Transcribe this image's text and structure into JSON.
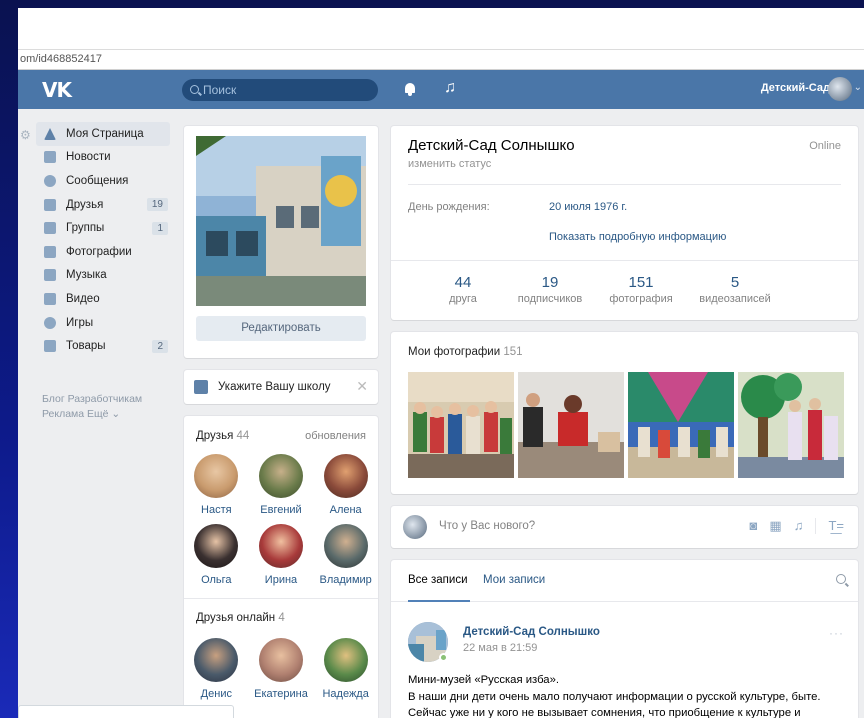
{
  "browser": {
    "url": "om/id468852417"
  },
  "header": {
    "logo": "VK",
    "search_placeholder": "Поиск",
    "user_name": "Детский-Сад",
    "icons": [
      "bell-icon",
      "music-icon",
      "chevron-down-icon"
    ]
  },
  "sidebar": {
    "items": [
      {
        "label": "Моя Страница",
        "icon": "house-icon",
        "badge": ""
      },
      {
        "label": "Новости",
        "icon": "news-icon",
        "badge": ""
      },
      {
        "label": "Сообщения",
        "icon": "message-icon",
        "badge": ""
      },
      {
        "label": "Друзья",
        "icon": "person-icon",
        "badge": "19"
      },
      {
        "label": "Группы",
        "icon": "group-icon",
        "badge": "1"
      },
      {
        "label": "Фотографии",
        "icon": "camera-icon",
        "badge": ""
      },
      {
        "label": "Музыка",
        "icon": "music-icon",
        "badge": ""
      },
      {
        "label": "Видео",
        "icon": "film-icon",
        "badge": ""
      },
      {
        "label": "Игры",
        "icon": "gamepad-icon",
        "badge": ""
      },
      {
        "label": "Товары",
        "icon": "bag-icon",
        "badge": "2"
      }
    ],
    "footer": {
      "line1": "Блог  Разработчикам",
      "line2": "Реклама  Ещё ⌄"
    }
  },
  "avatar_card": {
    "edit_label": "Редактировать"
  },
  "school": {
    "label": "Укажите Вашу школу",
    "close": "✕"
  },
  "friends": {
    "title": "Друзья",
    "count": "44",
    "updates": "обновления",
    "list": [
      {
        "name": "Настя",
        "color": "#c99b6e"
      },
      {
        "name": "Евгений",
        "color": "#6a7b4a"
      },
      {
        "name": "Алена",
        "color": "#8a4a3a"
      },
      {
        "name": "Ольга",
        "color": "#3a3030"
      },
      {
        "name": "Ирина",
        "color": "#a83a3a"
      },
      {
        "name": "Владимир",
        "color": "#5a6a6a"
      }
    ],
    "online_title": "Друзья онлайн",
    "online_count": "4",
    "online": [
      {
        "name": "Денис",
        "color": "#4a5a6a"
      },
      {
        "name": "Екатерина",
        "color": "#b08070"
      },
      {
        "name": "Надежда",
        "color": "#5a8a4a"
      }
    ]
  },
  "profile": {
    "name": "Детский-Сад Солнышко",
    "status": "изменить статус",
    "online": "Online",
    "birthday_label": "День рождения:",
    "birthday_value": "20 июля 1976 г.",
    "more_info": "Показать подробную информацию",
    "counters": [
      {
        "num": "44",
        "label": "друга"
      },
      {
        "num": "19",
        "label": "подписчиков"
      },
      {
        "num": "151",
        "label": "фотография"
      },
      {
        "num": "5",
        "label": "видеозаписей"
      }
    ]
  },
  "photos": {
    "title": "Мои фотографии",
    "count": "151"
  },
  "new_post": {
    "placeholder": "Что у Вас нового?"
  },
  "wall": {
    "tab_all": "Все записи",
    "tab_mine": "Мои записи",
    "post": {
      "author": "Детский-Сад Солнышко",
      "date": "22 мая в 21:59",
      "more": "···",
      "line1": "Мини-музей «Русская изба».",
      "line2": "В наши дни дети очень мало получают информации о русской культуре, быте.",
      "line3": "Сейчас уже ни у кого не вызывает сомнения, что приобщение к культуре и"
    }
  }
}
